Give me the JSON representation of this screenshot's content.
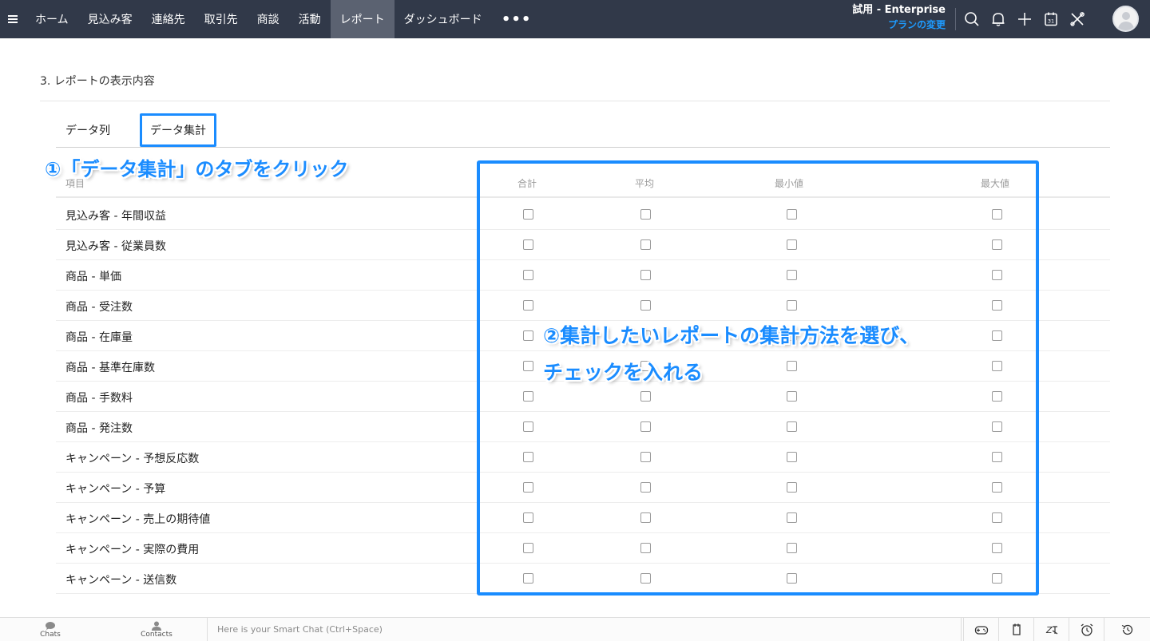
{
  "nav": {
    "items": [
      {
        "label": "ホーム",
        "active": false
      },
      {
        "label": "見込み客",
        "active": false
      },
      {
        "label": "連絡先",
        "active": false
      },
      {
        "label": "取引先",
        "active": false
      },
      {
        "label": "商談",
        "active": false
      },
      {
        "label": "活動",
        "active": false
      },
      {
        "label": "レポート",
        "active": true
      },
      {
        "label": "ダッシュボード",
        "active": false
      }
    ],
    "more": "•••",
    "edition": "試用 - Enterprise",
    "upgrade": "プランの変更",
    "icons": [
      "search-icon",
      "bell-icon",
      "plus-icon",
      "calendar-icon",
      "tools-icon"
    ],
    "calendar_day": "31"
  },
  "section": {
    "title": "3.  レポートの表示内容",
    "tabs": [
      {
        "label": "データ列",
        "highlighted": false
      },
      {
        "label": "データ集計",
        "highlighted": true
      }
    ]
  },
  "table": {
    "item_header": "項目",
    "columns": [
      "合計",
      "平均",
      "最小値",
      "最大値"
    ],
    "rows": [
      "見込み客 - 年間収益",
      "見込み客 - 従業員数",
      "商品 - 単価",
      "商品 - 受注数",
      "商品 - 在庫量",
      "商品 - 基準在庫数",
      "商品 - 手数料",
      "商品 - 発注数",
      "キャンペーン - 予想反応数",
      "キャンペーン - 予算",
      "キャンペーン - 売上の期待値",
      "キャンペーン - 実際の費用",
      "キャンペーン - 送信数"
    ]
  },
  "annotations": {
    "step1": "①「データ集計」のタブをクリック",
    "step2_line1": "②集計したいレポートの集計方法を選び、",
    "step2_line2": "チェックを入れる",
    "accent": "#1a8cff"
  },
  "bottom": {
    "chats": "Chats",
    "contacts": "Contacts",
    "chat_placeholder": "Here is your Smart Chat (Ctrl+Space)",
    "icons": [
      "gamepad-icon",
      "notes-icon",
      "translate-icon",
      "alarm-icon",
      "history-icon"
    ]
  }
}
